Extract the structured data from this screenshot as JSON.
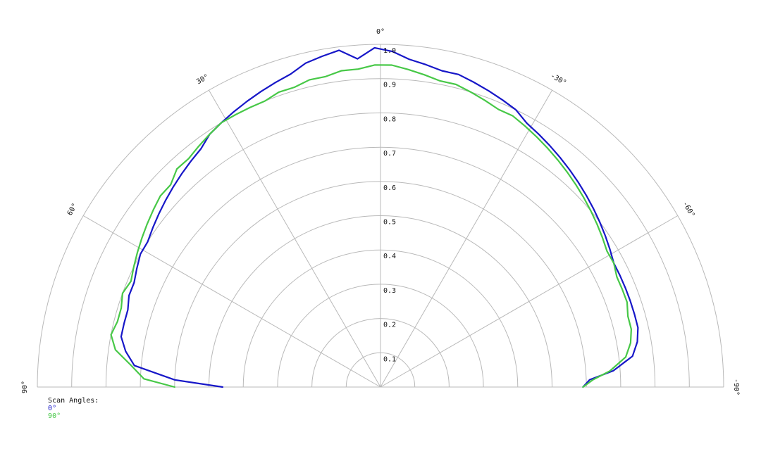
{
  "chart_data": {
    "type": "polar-line",
    "radial_ticks": [
      "0.1",
      "0.2",
      "0.3",
      "0.4",
      "0.5",
      "0.6",
      "0.7",
      "0.8",
      "0.9",
      "1.0"
    ],
    "radial_range": [
      0,
      1.0
    ],
    "angle_ticks": [
      {
        "angle": 90,
        "label": "90°"
      },
      {
        "angle": 60,
        "label": "60°"
      },
      {
        "angle": 30,
        "label": "30°"
      },
      {
        "angle": 0,
        "label": "0°"
      },
      {
        "angle": -30,
        "label": "-30°"
      },
      {
        "angle": -60,
        "label": "-60°"
      },
      {
        "angle": -90,
        "label": "-90°"
      }
    ],
    "grid": true,
    "legend": {
      "title": "Scan Angles:",
      "items": [
        {
          "name": "0°",
          "color": "#1717c8"
        },
        {
          "name": "90°",
          "color": "#47c847"
        }
      ]
    },
    "series": [
      {
        "name": "0°",
        "color": "#1717c8",
        "points": [
          [
            90,
            0.46
          ],
          [
            88,
            0.6
          ],
          [
            85,
            0.72
          ],
          [
            82,
            0.75
          ],
          [
            79,
            0.77
          ],
          [
            76,
            0.77
          ],
          [
            73,
            0.77
          ],
          [
            70,
            0.78
          ],
          [
            67,
            0.78
          ],
          [
            64,
            0.79
          ],
          [
            61,
            0.8
          ],
          [
            58,
            0.8
          ],
          [
            55,
            0.81
          ],
          [
            52,
            0.82
          ],
          [
            49,
            0.83
          ],
          [
            46,
            0.84
          ],
          [
            43,
            0.85
          ],
          [
            40,
            0.86
          ],
          [
            37,
            0.87
          ],
          [
            34,
            0.89
          ],
          [
            31,
            0.9
          ],
          [
            28,
            0.91
          ],
          [
            25,
            0.92
          ],
          [
            22,
            0.93
          ],
          [
            19,
            0.94
          ],
          [
            16,
            0.95
          ],
          [
            13,
            0.97
          ],
          [
            10,
            0.98
          ],
          [
            7,
            0.99
          ],
          [
            4,
            0.96
          ],
          [
            1,
            0.99
          ],
          [
            -2,
            0.98
          ],
          [
            -5,
            0.96
          ],
          [
            -8,
            0.95
          ],
          [
            -11,
            0.94
          ],
          [
            -14,
            0.94
          ],
          [
            -17,
            0.93
          ],
          [
            -20,
            0.92
          ],
          [
            -23,
            0.91
          ],
          [
            -26,
            0.9
          ],
          [
            -29,
            0.88
          ],
          [
            -32,
            0.87
          ],
          [
            -35,
            0.86
          ],
          [
            -38,
            0.85
          ],
          [
            -41,
            0.84
          ],
          [
            -44,
            0.83
          ],
          [
            -47,
            0.82
          ],
          [
            -50,
            0.81
          ],
          [
            -53,
            0.8
          ],
          [
            -56,
            0.79
          ],
          [
            -59,
            0.78
          ],
          [
            -62,
            0.77
          ],
          [
            -65,
            0.77
          ],
          [
            -68,
            0.77
          ],
          [
            -71,
            0.77
          ],
          [
            -74,
            0.77
          ],
          [
            -77,
            0.77
          ],
          [
            -80,
            0.76
          ],
          [
            -83,
            0.74
          ],
          [
            -86,
            0.68
          ],
          [
            -88,
            0.61
          ],
          [
            -90,
            0.59
          ]
        ]
      },
      {
        "name": "90°",
        "color": "#47c847",
        "points": [
          [
            90,
            0.6
          ],
          [
            88,
            0.69
          ],
          [
            85,
            0.73
          ],
          [
            82,
            0.78
          ],
          [
            79,
            0.8
          ],
          [
            76,
            0.79
          ],
          [
            73,
            0.79
          ],
          [
            70,
            0.8
          ],
          [
            67,
            0.79
          ],
          [
            64,
            0.8
          ],
          [
            61,
            0.81
          ],
          [
            58,
            0.82
          ],
          [
            55,
            0.83
          ],
          [
            52,
            0.84
          ],
          [
            49,
            0.85
          ],
          [
            46,
            0.85
          ],
          [
            43,
            0.87
          ],
          [
            40,
            0.87
          ],
          [
            37,
            0.88
          ],
          [
            34,
            0.89
          ],
          [
            31,
            0.9
          ],
          [
            28,
            0.9
          ],
          [
            25,
            0.9
          ],
          [
            22,
            0.9
          ],
          [
            19,
            0.91
          ],
          [
            16,
            0.91
          ],
          [
            13,
            0.92
          ],
          [
            10,
            0.92
          ],
          [
            7,
            0.93
          ],
          [
            4,
            0.93
          ],
          [
            1,
            0.94
          ],
          [
            -2,
            0.94
          ],
          [
            -5,
            0.93
          ],
          [
            -8,
            0.92
          ],
          [
            -11,
            0.91
          ],
          [
            -14,
            0.91
          ],
          [
            -17,
            0.9
          ],
          [
            -20,
            0.89
          ],
          [
            -23,
            0.88
          ],
          [
            -26,
            0.88
          ],
          [
            -29,
            0.87
          ],
          [
            -32,
            0.86
          ],
          [
            -35,
            0.85
          ],
          [
            -38,
            0.84
          ],
          [
            -41,
            0.83
          ],
          [
            -44,
            0.82
          ],
          [
            -47,
            0.81
          ],
          [
            -50,
            0.8
          ],
          [
            -53,
            0.79
          ],
          [
            -56,
            0.78
          ],
          [
            -59,
            0.77
          ],
          [
            -62,
            0.77
          ],
          [
            -65,
            0.76
          ],
          [
            -68,
            0.76
          ],
          [
            -71,
            0.76
          ],
          [
            -74,
            0.75
          ],
          [
            -77,
            0.75
          ],
          [
            -80,
            0.74
          ],
          [
            -83,
            0.72
          ],
          [
            -86,
            0.67
          ],
          [
            -88,
            0.62
          ],
          [
            -90,
            0.59
          ]
        ]
      }
    ]
  }
}
